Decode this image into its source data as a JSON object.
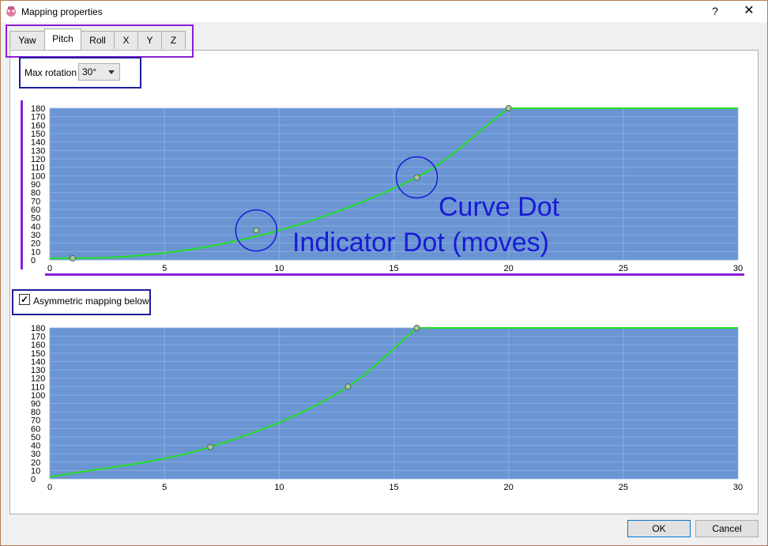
{
  "window": {
    "title": "Mapping properties",
    "help_label": "?",
    "close_label": "✕"
  },
  "tabs": [
    {
      "label": "Yaw",
      "active": false
    },
    {
      "label": "Pitch",
      "active": true
    },
    {
      "label": "Roll",
      "active": false
    },
    {
      "label": "X",
      "active": false
    },
    {
      "label": "Y",
      "active": false
    },
    {
      "label": "Z",
      "active": false
    }
  ],
  "max_rotation": {
    "label": "Max rotation",
    "value": "30°"
  },
  "asymmetric": {
    "label": "Asymmetric mapping below",
    "checked": true,
    "check_glyph": "✓"
  },
  "buttons": {
    "ok": "OK",
    "cancel": "Cancel"
  },
  "annotations": {
    "curve_dot": "Curve Dot",
    "indicator_dot": "Indicator Dot (moves)"
  },
  "colors": {
    "plot_bg": "#6a95d2",
    "curve": "#22e022",
    "grid": "#8fb1e3",
    "annotation": "#1a1ad6",
    "highlight": "#8a1ed8"
  },
  "chart_data": [
    {
      "type": "line",
      "xlim": [
        0,
        30
      ],
      "ylim": [
        0,
        180
      ],
      "x_ticks": [
        "0",
        "5",
        "10",
        "15",
        "20",
        "25",
        "30"
      ],
      "y_ticks": [
        "0",
        "10",
        "20",
        "30",
        "40",
        "50",
        "60",
        "70",
        "80",
        "90",
        "100",
        "110",
        "120",
        "130",
        "140",
        "150",
        "160",
        "170",
        "180"
      ],
      "curve_points": [
        [
          1,
          2
        ],
        [
          16,
          98
        ],
        [
          20,
          180
        ]
      ],
      "indicator_point": [
        9,
        35
      ],
      "curve_end": [
        30,
        180
      ],
      "grid": true
    },
    {
      "type": "line",
      "xlim": [
        0,
        30
      ],
      "ylim": [
        0,
        180
      ],
      "x_ticks": [
        "0",
        "5",
        "10",
        "15",
        "20",
        "25",
        "30"
      ],
      "y_ticks": [
        "0",
        "10",
        "20",
        "30",
        "40",
        "50",
        "60",
        "70",
        "80",
        "90",
        "100",
        "110",
        "120",
        "130",
        "140",
        "150",
        "160",
        "170",
        "180"
      ],
      "curve_points": [
        [
          7,
          38
        ],
        [
          13,
          110
        ],
        [
          16,
          180
        ]
      ],
      "curve_end": [
        30,
        180
      ],
      "grid": true
    }
  ]
}
